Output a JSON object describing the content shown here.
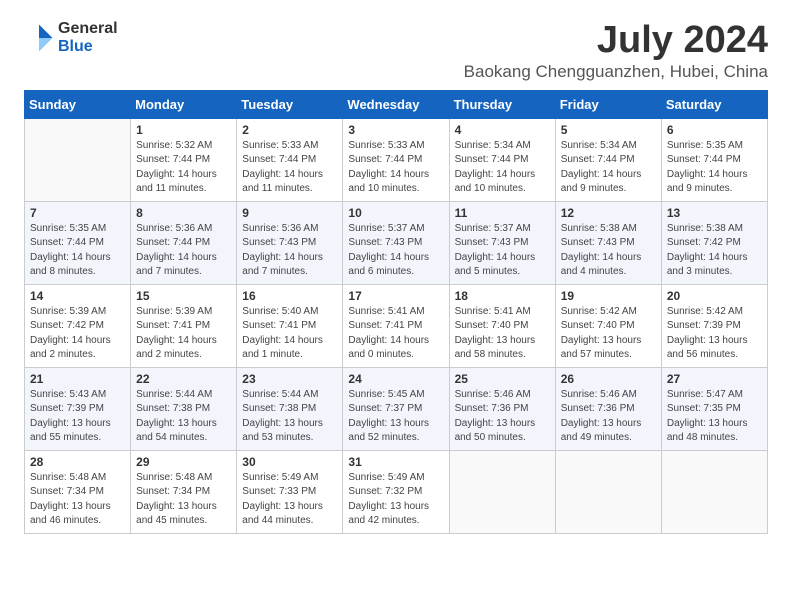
{
  "logo": {
    "general": "General",
    "blue": "Blue"
  },
  "header": {
    "month": "July 2024",
    "location": "Baokang Chengguanzhen, Hubei, China"
  },
  "days_of_week": [
    "Sunday",
    "Monday",
    "Tuesday",
    "Wednesday",
    "Thursday",
    "Friday",
    "Saturday"
  ],
  "weeks": [
    [
      {
        "day": "",
        "info": ""
      },
      {
        "day": "1",
        "info": "Sunrise: 5:32 AM\nSunset: 7:44 PM\nDaylight: 14 hours\nand 11 minutes."
      },
      {
        "day": "2",
        "info": "Sunrise: 5:33 AM\nSunset: 7:44 PM\nDaylight: 14 hours\nand 11 minutes."
      },
      {
        "day": "3",
        "info": "Sunrise: 5:33 AM\nSunset: 7:44 PM\nDaylight: 14 hours\nand 10 minutes."
      },
      {
        "day": "4",
        "info": "Sunrise: 5:34 AM\nSunset: 7:44 PM\nDaylight: 14 hours\nand 10 minutes."
      },
      {
        "day": "5",
        "info": "Sunrise: 5:34 AM\nSunset: 7:44 PM\nDaylight: 14 hours\nand 9 minutes."
      },
      {
        "day": "6",
        "info": "Sunrise: 5:35 AM\nSunset: 7:44 PM\nDaylight: 14 hours\nand 9 minutes."
      }
    ],
    [
      {
        "day": "7",
        "info": "Sunrise: 5:35 AM\nSunset: 7:44 PM\nDaylight: 14 hours\nand 8 minutes."
      },
      {
        "day": "8",
        "info": "Sunrise: 5:36 AM\nSunset: 7:44 PM\nDaylight: 14 hours\nand 7 minutes."
      },
      {
        "day": "9",
        "info": "Sunrise: 5:36 AM\nSunset: 7:43 PM\nDaylight: 14 hours\nand 7 minutes."
      },
      {
        "day": "10",
        "info": "Sunrise: 5:37 AM\nSunset: 7:43 PM\nDaylight: 14 hours\nand 6 minutes."
      },
      {
        "day": "11",
        "info": "Sunrise: 5:37 AM\nSunset: 7:43 PM\nDaylight: 14 hours\nand 5 minutes."
      },
      {
        "day": "12",
        "info": "Sunrise: 5:38 AM\nSunset: 7:43 PM\nDaylight: 14 hours\nand 4 minutes."
      },
      {
        "day": "13",
        "info": "Sunrise: 5:38 AM\nSunset: 7:42 PM\nDaylight: 14 hours\nand 3 minutes."
      }
    ],
    [
      {
        "day": "14",
        "info": "Sunrise: 5:39 AM\nSunset: 7:42 PM\nDaylight: 14 hours\nand 2 minutes."
      },
      {
        "day": "15",
        "info": "Sunrise: 5:39 AM\nSunset: 7:41 PM\nDaylight: 14 hours\nand 2 minutes."
      },
      {
        "day": "16",
        "info": "Sunrise: 5:40 AM\nSunset: 7:41 PM\nDaylight: 14 hours\nand 1 minute."
      },
      {
        "day": "17",
        "info": "Sunrise: 5:41 AM\nSunset: 7:41 PM\nDaylight: 14 hours\nand 0 minutes."
      },
      {
        "day": "18",
        "info": "Sunrise: 5:41 AM\nSunset: 7:40 PM\nDaylight: 13 hours\nand 58 minutes."
      },
      {
        "day": "19",
        "info": "Sunrise: 5:42 AM\nSunset: 7:40 PM\nDaylight: 13 hours\nand 57 minutes."
      },
      {
        "day": "20",
        "info": "Sunrise: 5:42 AM\nSunset: 7:39 PM\nDaylight: 13 hours\nand 56 minutes."
      }
    ],
    [
      {
        "day": "21",
        "info": "Sunrise: 5:43 AM\nSunset: 7:39 PM\nDaylight: 13 hours\nand 55 minutes."
      },
      {
        "day": "22",
        "info": "Sunrise: 5:44 AM\nSunset: 7:38 PM\nDaylight: 13 hours\nand 54 minutes."
      },
      {
        "day": "23",
        "info": "Sunrise: 5:44 AM\nSunset: 7:38 PM\nDaylight: 13 hours\nand 53 minutes."
      },
      {
        "day": "24",
        "info": "Sunrise: 5:45 AM\nSunset: 7:37 PM\nDaylight: 13 hours\nand 52 minutes."
      },
      {
        "day": "25",
        "info": "Sunrise: 5:46 AM\nSunset: 7:36 PM\nDaylight: 13 hours\nand 50 minutes."
      },
      {
        "day": "26",
        "info": "Sunrise: 5:46 AM\nSunset: 7:36 PM\nDaylight: 13 hours\nand 49 minutes."
      },
      {
        "day": "27",
        "info": "Sunrise: 5:47 AM\nSunset: 7:35 PM\nDaylight: 13 hours\nand 48 minutes."
      }
    ],
    [
      {
        "day": "28",
        "info": "Sunrise: 5:48 AM\nSunset: 7:34 PM\nDaylight: 13 hours\nand 46 minutes."
      },
      {
        "day": "29",
        "info": "Sunrise: 5:48 AM\nSunset: 7:34 PM\nDaylight: 13 hours\nand 45 minutes."
      },
      {
        "day": "30",
        "info": "Sunrise: 5:49 AM\nSunset: 7:33 PM\nDaylight: 13 hours\nand 44 minutes."
      },
      {
        "day": "31",
        "info": "Sunrise: 5:49 AM\nSunset: 7:32 PM\nDaylight: 13 hours\nand 42 minutes."
      },
      {
        "day": "",
        "info": ""
      },
      {
        "day": "",
        "info": ""
      },
      {
        "day": "",
        "info": ""
      }
    ]
  ]
}
